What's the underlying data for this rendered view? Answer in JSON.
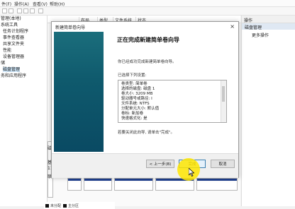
{
  "menu": [
    "件(F)",
    "操作(A)",
    "查看(V)",
    "帮助(H)"
  ],
  "tree": {
    "items": [
      {
        "label": "管理(本地)",
        "selected": false
      },
      {
        "label": "系统工具",
        "selected": false
      },
      {
        "label": "任务计划程序",
        "selected": false
      },
      {
        "label": "事件查看器",
        "selected": false
      },
      {
        "label": "共享文件夹",
        "selected": false
      },
      {
        "label": "性能",
        "selected": false
      },
      {
        "label": "设备管理器",
        "selected": false
      },
      {
        "label": "储",
        "selected": false
      },
      {
        "label": "磁盘管理",
        "selected": true
      },
      {
        "label": "务和应用程序",
        "selected": false
      }
    ]
  },
  "list_headers": [
    "布局",
    "类型",
    "文件系统",
    "状态"
  ],
  "actions": {
    "header": "操作",
    "section": "磁盘管理",
    "more": "更多操作"
  },
  "legend": [
    {
      "label": "未分配",
      "color": "#111111"
    },
    {
      "label": "主分区",
      "color": "#111111"
    }
  ],
  "wizard": {
    "title": "新建简单卷向导",
    "close_glyph": "×",
    "heading": "正在完成新建简单卷向导",
    "intro": "你已经成功完成新建简单卷向导。",
    "selected_label": "已选择下列设置:",
    "settings": [
      "卷类型: 简单卷",
      "选择的磁盘: 磁盘 1",
      "卷大小: 3209 MB",
      "驱动器号或路径: I",
      "文件系统: NTFS",
      "分配单元大小: 默认值",
      "卷标: 新加卷",
      "快速格式化: 是"
    ],
    "finish_hint": "若要关闭此向导, 请单击\"完成\"。",
    "buttons": {
      "back": "< 上一步(B)",
      "finish": "完成",
      "cancel": "取消"
    }
  },
  "disk_map": {
    "left_labels": [
      "磁",
      "基",
      "11",
      "联"
    ]
  }
}
